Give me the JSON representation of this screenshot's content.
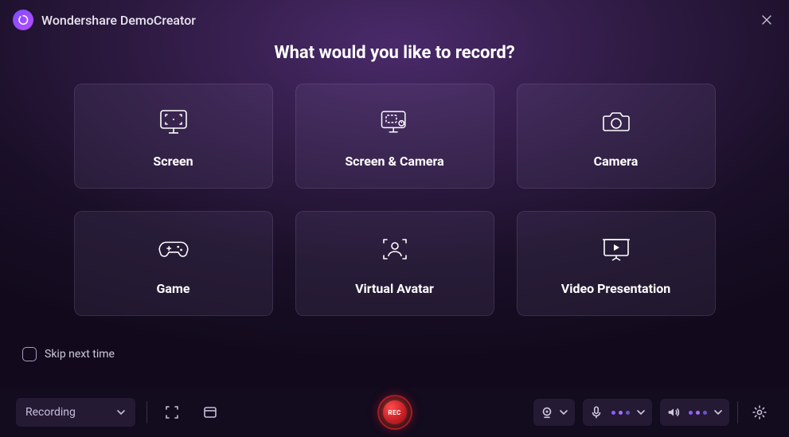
{
  "app": {
    "title": "Wondershare DemoCreator"
  },
  "heading": "What would you like to record?",
  "cards": [
    {
      "label": "Screen"
    },
    {
      "label": "Screen & Camera"
    },
    {
      "label": "Camera"
    },
    {
      "label": "Game"
    },
    {
      "label": "Virtual Avatar"
    },
    {
      "label": "Video Presentation"
    }
  ],
  "skip": {
    "label": "Skip next time",
    "checked": false
  },
  "bottombar": {
    "mode": "Recording",
    "record_label": "REC"
  }
}
